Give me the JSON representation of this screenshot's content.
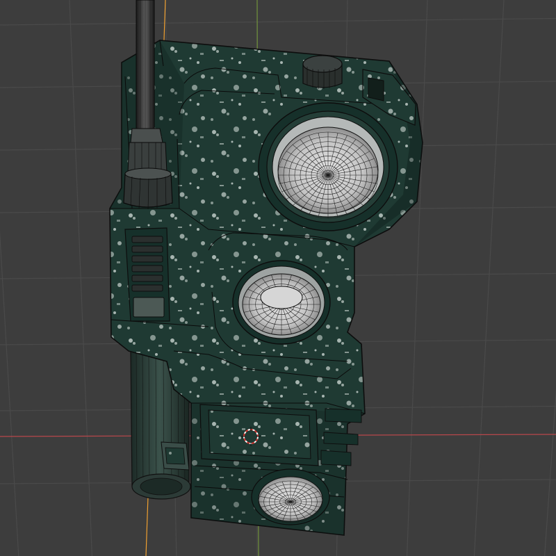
{
  "viewport": {
    "background_color": "#3d3d3d",
    "grid_color": "#4a4a4a",
    "x_axis_color": "#b8474b",
    "y_axis_color": "#7aa23a",
    "z_axis_color": "#f0a030",
    "wireframe_color": "#111111",
    "model_body_color": "#1f3a33",
    "model_body_light": "#2c4f46",
    "model_body_dark": "#142621",
    "camo_speckle_color": "#c9d3cf",
    "speaker_mesh_color": "#c6c6c6",
    "rim_color": "#2a2a2a"
  },
  "scene": {
    "object": "radio-model",
    "parts": [
      "antenna",
      "antenna-base",
      "top-knob",
      "top-clip",
      "main-speaker",
      "mid-speaker",
      "side-grip",
      "lower-panel",
      "bottom-speaker",
      "battery-cylinder",
      "side-button"
    ],
    "cursor": "3d-cursor-icon"
  }
}
